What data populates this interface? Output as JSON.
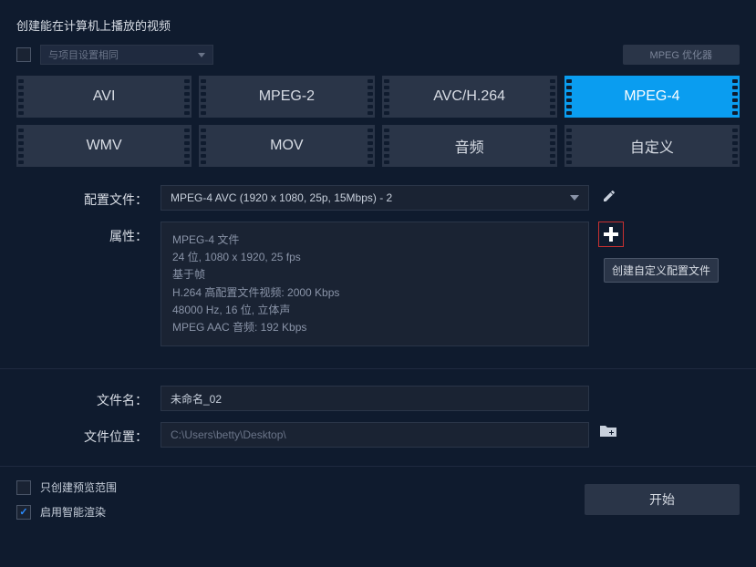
{
  "title": "创建能在计算机上播放的视频",
  "top": {
    "use_project_settings": "与项目设置相同",
    "mpeg_optimizer": "MPEG 优化器"
  },
  "formats": [
    "AVI",
    "MPEG-2",
    "AVC/H.264",
    "MPEG-4",
    "WMV",
    "MOV",
    "音频",
    "自定义"
  ],
  "selected_format_index": 3,
  "labels": {
    "profile": "配置文件：",
    "attrs": "属性：",
    "filename": "文件名：",
    "filepath": "文件位置："
  },
  "profile": "MPEG-4 AVC (1920 x 1080, 25p, 15Mbps) - 2",
  "attrs": [
    "MPEG-4 文件",
    "24 位, 1080 x 1920, 25 fps",
    "基于帧",
    "H.264 高配置文件视频: 2000 Kbps",
    "48000 Hz, 16 位, 立体声",
    "MPEG AAC 音频: 192 Kbps"
  ],
  "tooltip": "创建自定义配置文件",
  "filename": "未命名_02",
  "filepath": "C:\\Users\\betty\\Desktop\\",
  "bottom": {
    "preview_only": "只创建预览范围",
    "smart_render": "启用智能渲染",
    "start": "开始"
  }
}
